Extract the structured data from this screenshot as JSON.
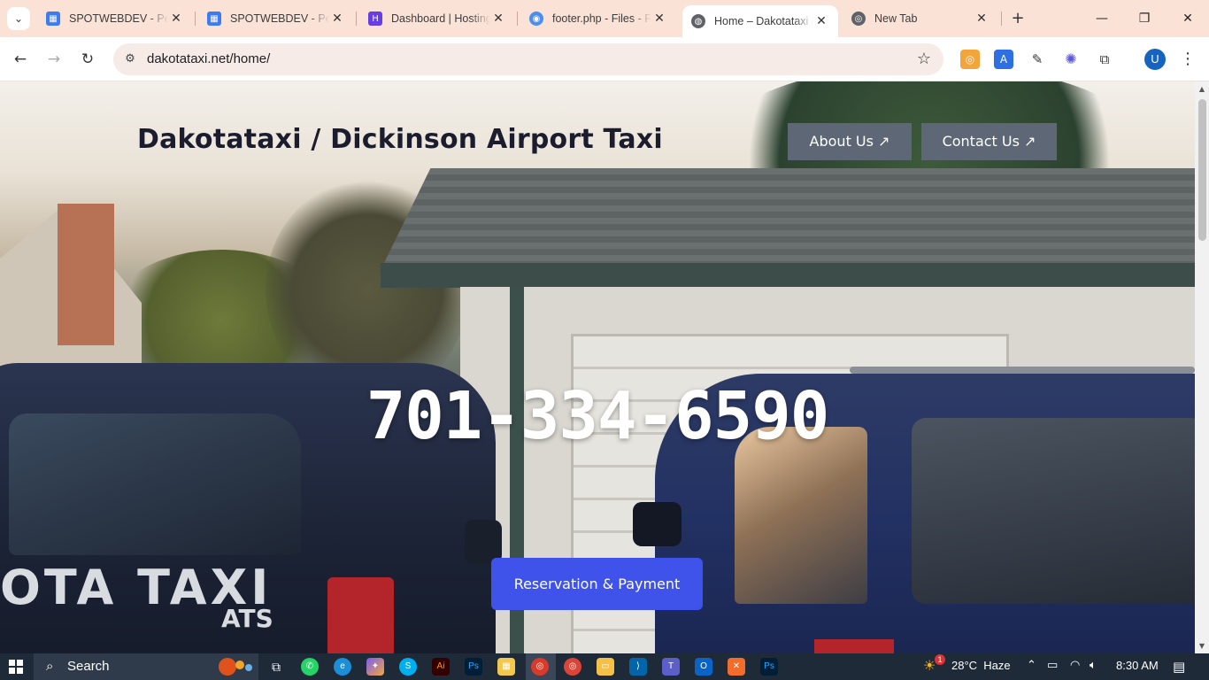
{
  "browser": {
    "tabs": [
      {
        "title": "SPOTWEBDEV - Personal",
        "favicon": "blue-grid"
      },
      {
        "title": "SPOTWEBDEV - Personal",
        "favicon": "blue-grid"
      },
      {
        "title": "Dashboard | Hostinger",
        "favicon": "hostinger-h"
      },
      {
        "title": "footer.php - Files - FileZilla",
        "favicon": "file-blue"
      },
      {
        "title": "Home – Dakotataxi / Dickinson",
        "favicon": "globe",
        "active": true
      },
      {
        "title": "New Tab",
        "favicon": "chrome"
      }
    ],
    "url": "dakotataxi.net/home/",
    "profile_initial": "U"
  },
  "site": {
    "title": "Dakotataxi / Dickinson Airport Taxi",
    "nav": [
      {
        "label": "About Us ↗"
      },
      {
        "label": "Contact Us ↗"
      }
    ],
    "phone": "701-334-6590",
    "cta_label": "Reservation & Payment",
    "car_lettering": "OTA TAXI",
    "car_lettering_sub": "ATS"
  },
  "taskbar": {
    "search_label": "Search",
    "weather": "28°C  Haze",
    "weather_badge": "1",
    "time": "8:30 AM"
  },
  "colors": {
    "accent_button": "#3f53ea",
    "nav_button": "#5d6775",
    "tab_strip": "#fbe2d6"
  }
}
